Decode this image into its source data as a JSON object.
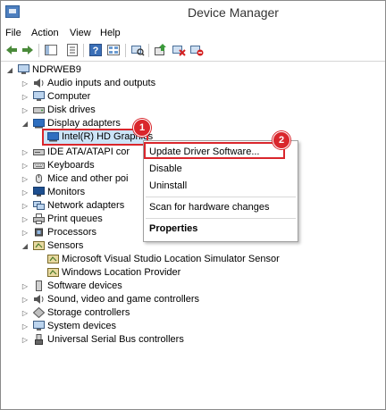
{
  "window": {
    "title": "Device Manager"
  },
  "menubar": {
    "items": [
      "File",
      "Action",
      "View",
      "Help"
    ]
  },
  "toolbar": {
    "buttons": [
      "back-arrow-icon",
      "forward-arrow-icon",
      "show-hide-tree-icon",
      "properties-icon",
      "help-icon",
      "view-icon",
      "scan-hardware-icon",
      "update-driver-icon",
      "uninstall-icon",
      "disable-icon"
    ]
  },
  "tree": {
    "root": "NDRWEB9",
    "categories": [
      {
        "label": "Audio inputs and outputs",
        "icon": "speaker-icon"
      },
      {
        "label": "Computer",
        "icon": "computer-icon"
      },
      {
        "label": "Disk drives",
        "icon": "disk-drive-icon"
      },
      {
        "label": "Display adapters",
        "icon": "display-adapter-icon",
        "expanded": true,
        "children": [
          "Intel(R) HD Graphics"
        ]
      },
      {
        "label": "IDE ATA/ATAPI cor",
        "icon": "ide-controller-icon"
      },
      {
        "label": "Keyboards",
        "icon": "keyboard-icon"
      },
      {
        "label": "Mice and other poi",
        "icon": "mouse-icon"
      },
      {
        "label": "Monitors",
        "icon": "monitor-icon"
      },
      {
        "label": "Network adapters",
        "icon": "network-adapter-icon"
      },
      {
        "label": "Print queues",
        "icon": "printer-icon"
      },
      {
        "label": "Processors",
        "icon": "processor-icon"
      },
      {
        "label": "Sensors",
        "icon": "sensor-icon",
        "expanded": true,
        "children": [
          "Microsoft Visual Studio Location Simulator Sensor",
          "Windows Location Provider"
        ]
      },
      {
        "label": "Software devices",
        "icon": "software-device-icon"
      },
      {
        "label": "Sound, video and game controllers",
        "icon": "sound-icon"
      },
      {
        "label": "Storage controllers",
        "icon": "storage-controller-icon"
      },
      {
        "label": "System devices",
        "icon": "system-device-icon"
      },
      {
        "label": "Universal Serial Bus controllers",
        "icon": "usb-icon"
      }
    ]
  },
  "context_menu": {
    "items": [
      "Update Driver Software...",
      "Disable",
      "Uninstall",
      "Scan for hardware changes",
      "Properties"
    ]
  },
  "callouts": {
    "first": "1",
    "second": "2"
  },
  "colors": {
    "callout": "#d9262c",
    "selection": "#cce4f7"
  }
}
